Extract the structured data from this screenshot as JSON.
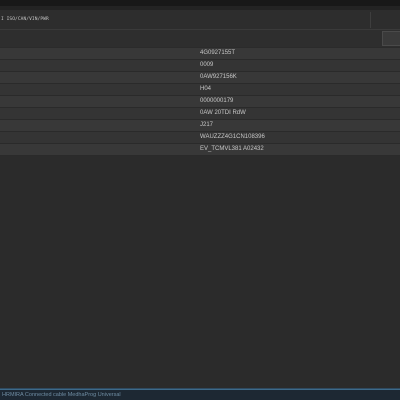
{
  "toolbar": {
    "path": "I ISO/CAN/VIN/PWR"
  },
  "parameters": [
    {
      "value": "4G0927155T"
    },
    {
      "value": "0009"
    },
    {
      "value": "0AW927156K"
    },
    {
      "value": "H04"
    },
    {
      "value": "0000000179"
    },
    {
      "value": "0AW 20TDI RdW"
    },
    {
      "value": "J217"
    },
    {
      "value": "WAUZZZ4G1CN108396"
    },
    {
      "value": "EV_TCMVL381 A02432"
    }
  ],
  "status_bar": {
    "text": "HRMIRA   Connected cable MedhaProg Universal"
  }
}
